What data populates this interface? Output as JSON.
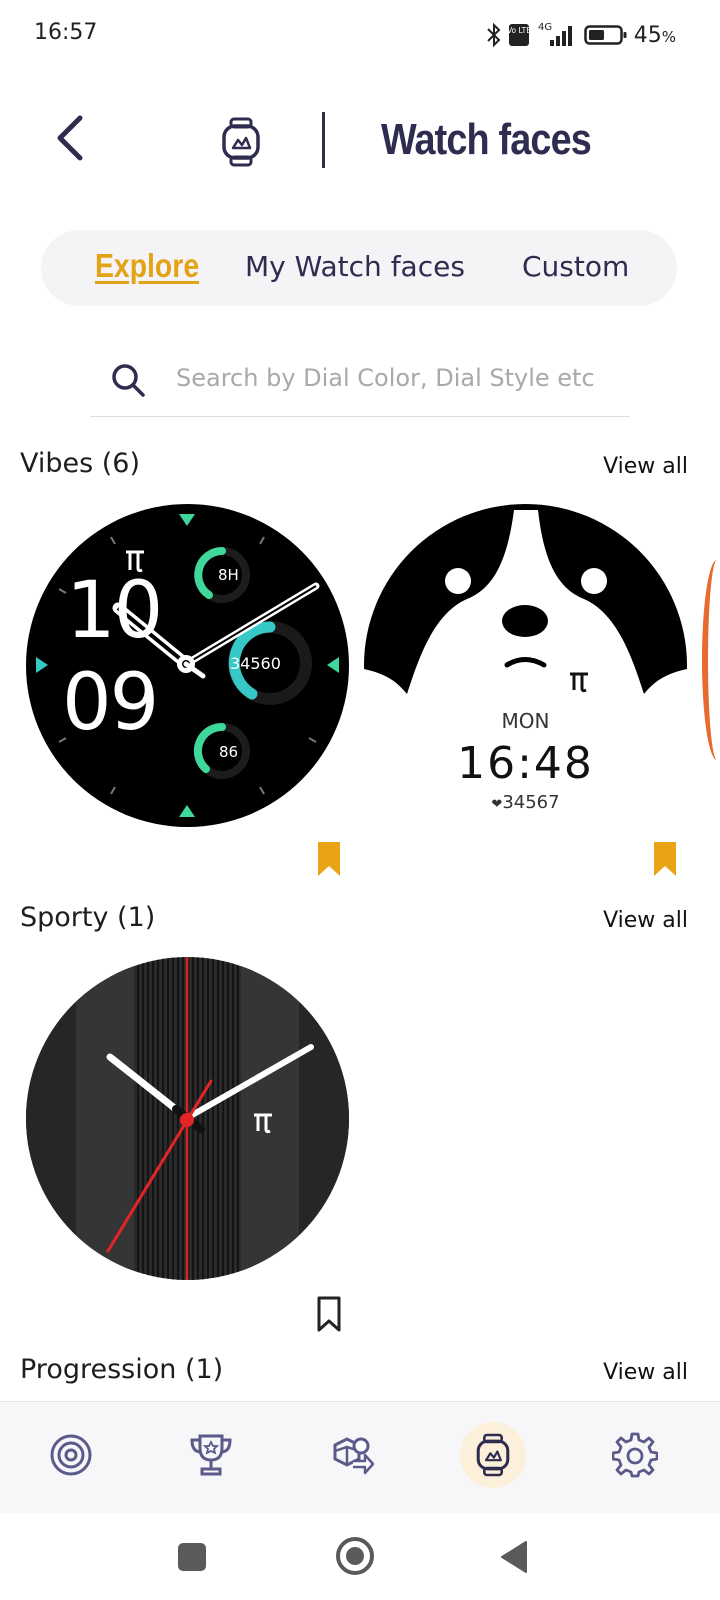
{
  "status_bar": {
    "time": "16:57",
    "network": "4G",
    "volte": "Vo LTE",
    "battery_percent": "45",
    "percent_sign": "%",
    "icons": [
      "bluetooth-icon",
      "volte-icon",
      "signal-icon",
      "battery-icon"
    ]
  },
  "header": {
    "title": "Watch faces",
    "icons": [
      "back-arrow-icon",
      "watch-icon"
    ]
  },
  "tabs": [
    {
      "label": "Explore",
      "active": true
    },
    {
      "label": "My Watch faces",
      "active": false
    },
    {
      "label": "Custom",
      "active": false
    }
  ],
  "search": {
    "placeholder": "Search by Dial Color, Dial Style etc",
    "value": ""
  },
  "sections": [
    {
      "title": "Vibes (6)",
      "view_all": "View all",
      "faces": [
        {
          "name": "vibes-face-1",
          "hour": "10",
          "minute": "09",
          "widgets": [
            "8H",
            "34560",
            "86"
          ],
          "bookmarked": true
        },
        {
          "name": "vibes-face-2",
          "day": "MON",
          "time": "16:48",
          "steps": "34567",
          "bookmarked": true
        }
      ]
    },
    {
      "title": "Sporty (1)",
      "view_all": "View all",
      "faces": [
        {
          "name": "sporty-face-1",
          "bookmarked": false
        }
      ]
    },
    {
      "title": "Progression (1)",
      "view_all": "View all"
    }
  ],
  "colors": {
    "accent": "#e4a317",
    "primary": "#2e2c4f",
    "nav_icon": "#5b5a8a",
    "active_nav_bg": "#fdf0da",
    "face_green": "#3ed99a",
    "face_teal": "#36c7c7",
    "second_hand_red": "#e32525"
  },
  "bottom_nav": [
    {
      "icon": "target-icon",
      "active": false
    },
    {
      "icon": "trophy-icon",
      "active": false
    },
    {
      "icon": "goals-icon",
      "active": false
    },
    {
      "icon": "watch-face-icon",
      "active": true
    },
    {
      "icon": "settings-icon",
      "active": false
    }
  ],
  "system_nav": [
    "recents-icon",
    "home-icon",
    "back-icon"
  ]
}
